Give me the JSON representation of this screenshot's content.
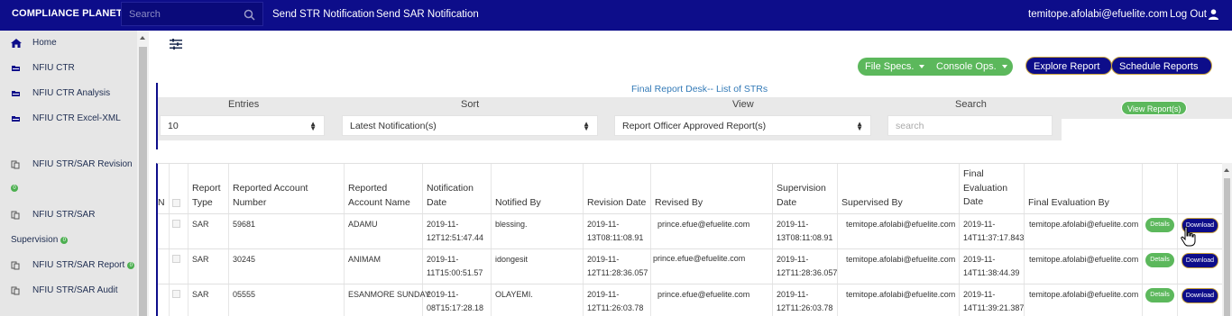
{
  "topbar": {
    "brand": "COMPLIANCE PLANET",
    "search_placeholder": "Search",
    "nav": [
      "Send STR Notification",
      "Send SAR Notification"
    ],
    "user_email": "temitope.afolabi@efuelite.com",
    "logout": "Log Out"
  },
  "sidebar": {
    "items": [
      {
        "label": "Home",
        "icon": "home-icon"
      },
      {
        "label": "NFIU CTR",
        "icon": "folder-icon"
      },
      {
        "label": "NFIU CTR Analysis",
        "icon": "folder-icon"
      },
      {
        "label": "NFIU CTR Excel-XML",
        "icon": "folder-icon"
      },
      {
        "label": "NFIU STR/SAR Revision",
        "icon": "copy-icon",
        "badge": "0"
      },
      {
        "label": "NFIU STR/SAR",
        "label2": "Supervision",
        "icon": "copy-icon",
        "badge": "0"
      },
      {
        "label": "NFIU STR/SAR Report",
        "icon": "copy-icon",
        "badge": "0"
      },
      {
        "label": "NFIU STR/SAR Audit",
        "icon": "copy-icon"
      }
    ]
  },
  "toolbar": {
    "file_specs": "File Specs.",
    "console_ops": "Console Ops.",
    "explore_report": "Explore Report",
    "schedule_reports": "Schedule Reports"
  },
  "panel": {
    "title": "Final Report Desk-- List of STRs",
    "entries_label": "Entries",
    "entries_value": "10",
    "sort_label": "Sort",
    "sort_value": "Latest Notification(s)",
    "view_label": "View",
    "view_value": "Report Officer Approved Report(s)",
    "search_label": "Search",
    "search_placeholder": "search",
    "view_button": "View Report(s)"
  },
  "table": {
    "headers": {
      "sn": "N",
      "report_type": "Report Type",
      "account_number": "Reported Account Number",
      "account_name": "Reported Account Name",
      "notification_date": "Notification Date",
      "notified_by": "Notified By",
      "revision_date": "Revision Date",
      "revised_by": "Revised By",
      "supervision_date": "Supervision Date",
      "supervised_by": "Supervised By",
      "final_eval_date": "Final Evaluation Date",
      "final_eval_by": "Final Evaluation By"
    },
    "details_label": "Details",
    "download_label": "Download",
    "rows": [
      {
        "type": "SAR",
        "account_number": "59681",
        "account_name": "ADAMU",
        "notification_date_1": "2019-11-",
        "notification_date_2": "12T12:51:47.44",
        "notified_by": "blessing.",
        "revision_date_1": "2019-11-",
        "revision_date_2": "13T08:11:08.91",
        "revised_by": "prince.efue@efuelite.com",
        "supervision_date_1": "2019-11-",
        "supervision_date_2": "13T08:11:08.91",
        "supervised_by": "temitope.afolabi@efuelite.com",
        "final_date_1": "2019-11-",
        "final_date_2": "14T11:37:17.843",
        "final_by": "temitope.afolabi@efuelite.com"
      },
      {
        "type": "SAR",
        "account_number": "30245",
        "account_name": "ANIMAM",
        "notification_date_1": "2019-11-",
        "notification_date_2": "11T15:00:51.57",
        "notified_by": "idongesit",
        "revision_date_1": "2019-11-",
        "revision_date_2": "12T11:28:36.057",
        "revised_by": "prince.efue@efuelite.com",
        "supervision_date_1": "2019-11-",
        "supervision_date_2": "12T11:28:36.057",
        "supervised_by": "temitope.afolabi@efuelite.com",
        "final_date_1": "2019-11-",
        "final_date_2": "14T11:38:44.39",
        "final_by": "temitope.afolabi@efuelite.com"
      },
      {
        "type": "SAR",
        "account_number": "05555",
        "account_name": "ESANMORE SUNDAY",
        "notification_date_1": "2019-11-",
        "notification_date_2": "08T15:17:28.18",
        "notified_by": "OLAYEMI.",
        "revision_date_1": "2019-11-",
        "revision_date_2": "12T11:26:03.78",
        "revised_by": "prince.efue@efuelite.com",
        "supervision_date_1": "2019-11-",
        "supervision_date_2": "12T11:26:03.78",
        "supervised_by": "temitope.afolabi@efuelite.com",
        "final_date_1": "2019-11-",
        "final_date_2": "14T11:39:21.387",
        "final_by": "temitope.afolabi@efuelite.com"
      }
    ]
  }
}
